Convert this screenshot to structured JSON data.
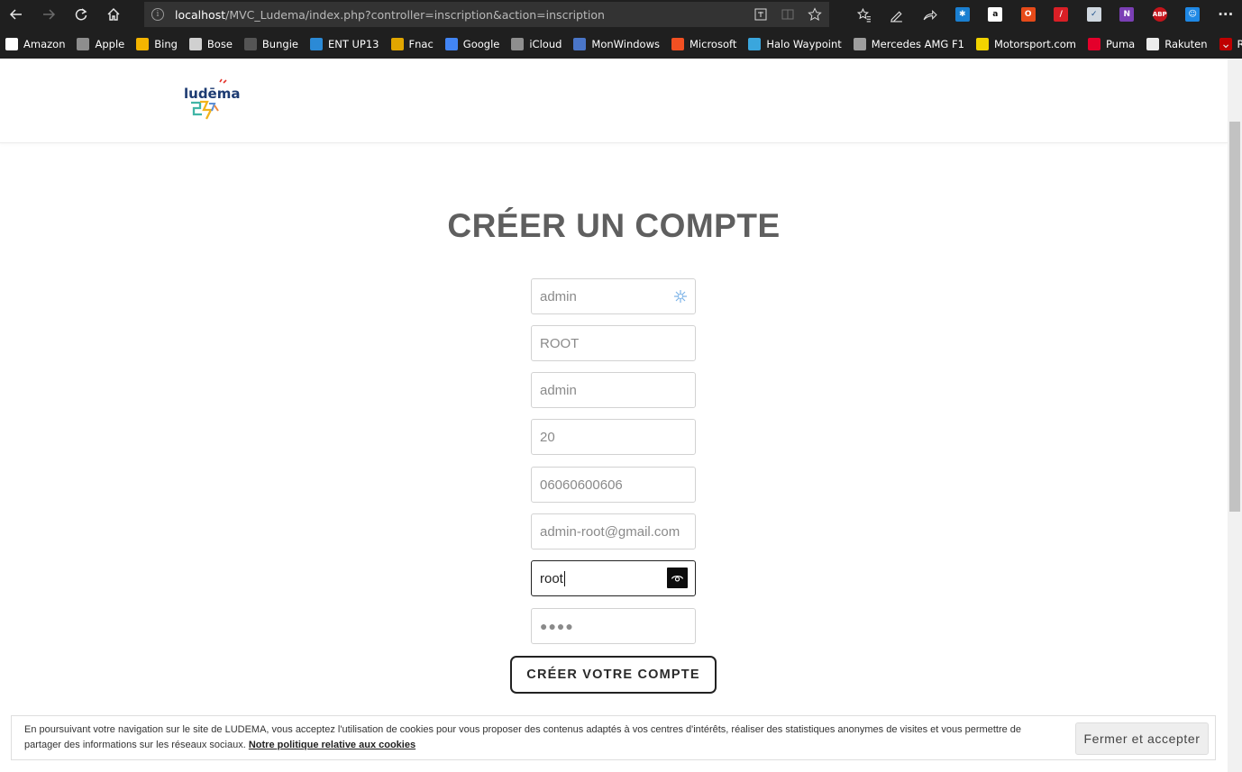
{
  "browser": {
    "address": {
      "host": "localhost",
      "path": "/MVC_Ludema/index.php?controller=inscription&action=inscription"
    },
    "bookmarks": [
      {
        "label": "Amazon",
        "icon": "amazon-icon",
        "color": "#ffffff"
      },
      {
        "label": "Apple",
        "icon": "apple-icon",
        "color": "#8e8e8e"
      },
      {
        "label": "Bing",
        "icon": "bing-icon",
        "color": "#f4b400"
      },
      {
        "label": "Bose",
        "icon": "bose-icon",
        "color": "#d0d0d0"
      },
      {
        "label": "Bungie",
        "icon": "bungie-icon",
        "color": "#555555"
      },
      {
        "label": "ENT UP13",
        "icon": "ent-icon",
        "color": "#2b8ad6"
      },
      {
        "label": "Fnac",
        "icon": "fnac-icon",
        "color": "#e1a600"
      },
      {
        "label": "Google",
        "icon": "google-icon",
        "color": "#4285f4"
      },
      {
        "label": "iCloud",
        "icon": "icloud-icon",
        "color": "#8e8e8e"
      },
      {
        "label": "MonWindows",
        "icon": "monwindows-icon",
        "color": "#4a76c9"
      },
      {
        "label": "Microsoft",
        "icon": "microsoft-icon",
        "color": "#f25022"
      },
      {
        "label": "Halo Waypoint",
        "icon": "halo-icon",
        "color": "#3aa6dd"
      },
      {
        "label": "Mercedes AMG F1",
        "icon": "mercedes-icon",
        "color": "#9e9e9e"
      },
      {
        "label": "Motorsport.com",
        "icon": "motorsport-icon",
        "color": "#f1d300"
      },
      {
        "label": "Puma",
        "icon": "puma-icon",
        "color": "#e4002b"
      },
      {
        "label": "Rakuten",
        "icon": "rakuten-icon",
        "color": "#ececec"
      },
      {
        "label": "Rakuten TV",
        "icon": "rakuten-tv-icon",
        "color": "#bf0000"
      }
    ]
  },
  "site": {
    "logo_text": "ludēma"
  },
  "form": {
    "title": "CRÉER UN COMPTE",
    "fields": [
      {
        "name": "username",
        "value": "admin"
      },
      {
        "name": "lastname",
        "value": "ROOT"
      },
      {
        "name": "firstname",
        "value": "admin"
      },
      {
        "name": "age",
        "value": "20"
      },
      {
        "name": "phone",
        "value": "06060600606"
      },
      {
        "name": "email",
        "value": "admin-root@gmail.com"
      },
      {
        "name": "password",
        "value": "root"
      },
      {
        "name": "password-confirm",
        "value": "●●●●"
      }
    ],
    "submit_label": "CRÉER VOTRE COMPTE"
  },
  "cookie": {
    "text": "En poursuivant votre navigation sur le site de LUDEMA, vous acceptez l'utilisation de cookies pour vous proposer des contenus adaptés à vos centres d'intérêts, réaliser des statistiques anonymes de visites et vous permettre de partager des informations sur les réseaux sociaux.",
    "link": "Notre politique relative aux cookies",
    "button": "Fermer et accepter"
  }
}
